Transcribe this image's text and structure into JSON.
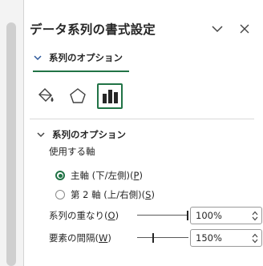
{
  "pane": {
    "title": "データ系列の書式設定",
    "section_tab": "系列のオプション"
  },
  "icon_tabs": [
    {
      "name": "fill-line-icon",
      "active": false
    },
    {
      "name": "effects-pentagon-icon",
      "active": false
    },
    {
      "name": "series-options-chart-icon",
      "active": true
    }
  ],
  "series_options": {
    "header": "系列のオプション",
    "axis_label": "使用する軸",
    "primary_axis": {
      "label": "主軸 (下/左側)(",
      "key": "P",
      "suffix": ")",
      "selected": true
    },
    "secondary_axis": {
      "label": "第 2 軸 (上/右側)(",
      "key": "S",
      "suffix": ")",
      "selected": false
    },
    "overlap": {
      "label": "系列の重なり(",
      "key": "O",
      "suffix": ")",
      "value": "100%",
      "level": 100
    },
    "gap_width": {
      "label": "要素の間隔(",
      "key": "W",
      "suffix": ")",
      "value": "150%",
      "level": 150
    }
  },
  "colors": {
    "accent": "#217346",
    "text": "#262626"
  }
}
